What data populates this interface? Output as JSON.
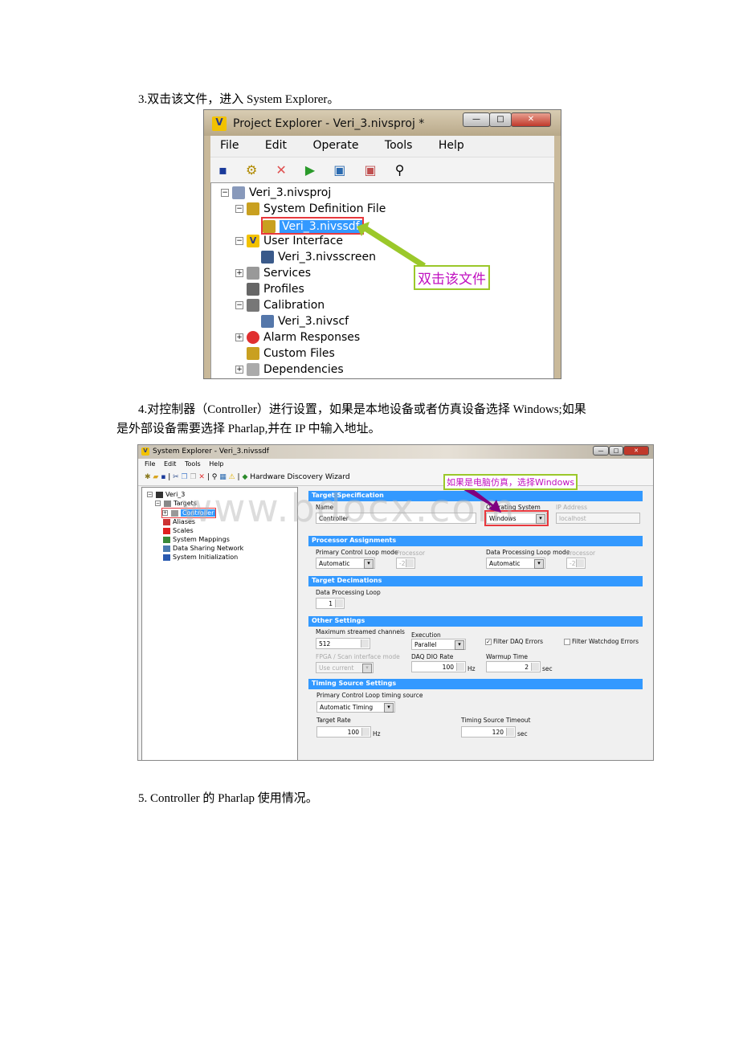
{
  "steps": {
    "step3": "3.双击该文件，进入 System Explorer。",
    "step4_line1": "4.对控制器（Controller）进行设置，如果是本地设备或者仿真设备选择 Windows;如果",
    "step4_line2": "是外部设备需要选择 Pharlap,并在 IP 中输入地址。",
    "step5": "5. Controller 的  Pharlap 使用情况。"
  },
  "project_explorer": {
    "title": "Project Explorer - Veri_3.nivsproj *",
    "menu": [
      "File",
      "Edit",
      "Operate",
      "Tools",
      "Help"
    ],
    "tree": [
      "Veri_3.nivsproj",
      "System Definition File",
      "Veri_3.nivssdf",
      "User Interface",
      "Veri_3.nivsscreen",
      "Services",
      "Profiles",
      "Calibration",
      "Veri_3.nivscf",
      "Alarm Responses",
      "Custom Files",
      "Dependencies"
    ],
    "callout": "双击该文件"
  },
  "system_explorer": {
    "title": "System Explorer - Veri_3.nivssdf",
    "menu": [
      "File",
      "Edit",
      "Tools",
      "Help"
    ],
    "toolbar_wizard": "Hardware Discovery Wizard",
    "tree": [
      "Veri_3",
      "Targets",
      "Controller",
      "Aliases",
      "Scales",
      "System Mappings",
      "Data Sharing Network",
      "System Initialization"
    ],
    "callout": "如果是电脑仿真，选择Windows",
    "sections": [
      "Target Specification",
      "Processor Assignments",
      "Target Decimations",
      "Other Settings",
      "Timing Source Settings"
    ],
    "target_spec": {
      "name_label": "Name",
      "name": "Controller",
      "os_label": "Operating System",
      "os": "Windows",
      "ip_label": "IP Address",
      "ip": "localhost"
    },
    "processor": {
      "pcl_label": "Primary Control Loop mode",
      "pcl": "Automatic",
      "proc_label": "Processor",
      "proc1": "-2",
      "dpl_label": "Data Processing Loop mode",
      "dpl": "Automatic",
      "proc2": "-2"
    },
    "decimations": {
      "label": "Data Processing Loop",
      "value": "1"
    },
    "other": {
      "max_label": "Maximum streamed channels",
      "max": "512",
      "exec_label": "Execution",
      "exec": "Parallel",
      "filter_daq": "Filter DAQ Errors",
      "filter_daq_checked": true,
      "filter_wd": "Filter Watchdog Errors",
      "filter_wd_checked": false,
      "fpga_label": "FPGA / Scan interface mode",
      "fpga": "Use current",
      "dio_label": "DAQ DIO Rate",
      "dio": "100",
      "hz": "Hz",
      "warm_label": "Warmup Time",
      "warm": "2",
      "sec": "sec"
    },
    "timing": {
      "src_label": "Primary Control Loop timing source",
      "src": "Automatic Timing",
      "rate_label": "Target Rate",
      "rate": "100",
      "hz": "Hz",
      "timeout_label": "Timing Source Timeout",
      "timeout": "120",
      "sec": "sec"
    }
  },
  "watermark": "www.bdocx.com"
}
